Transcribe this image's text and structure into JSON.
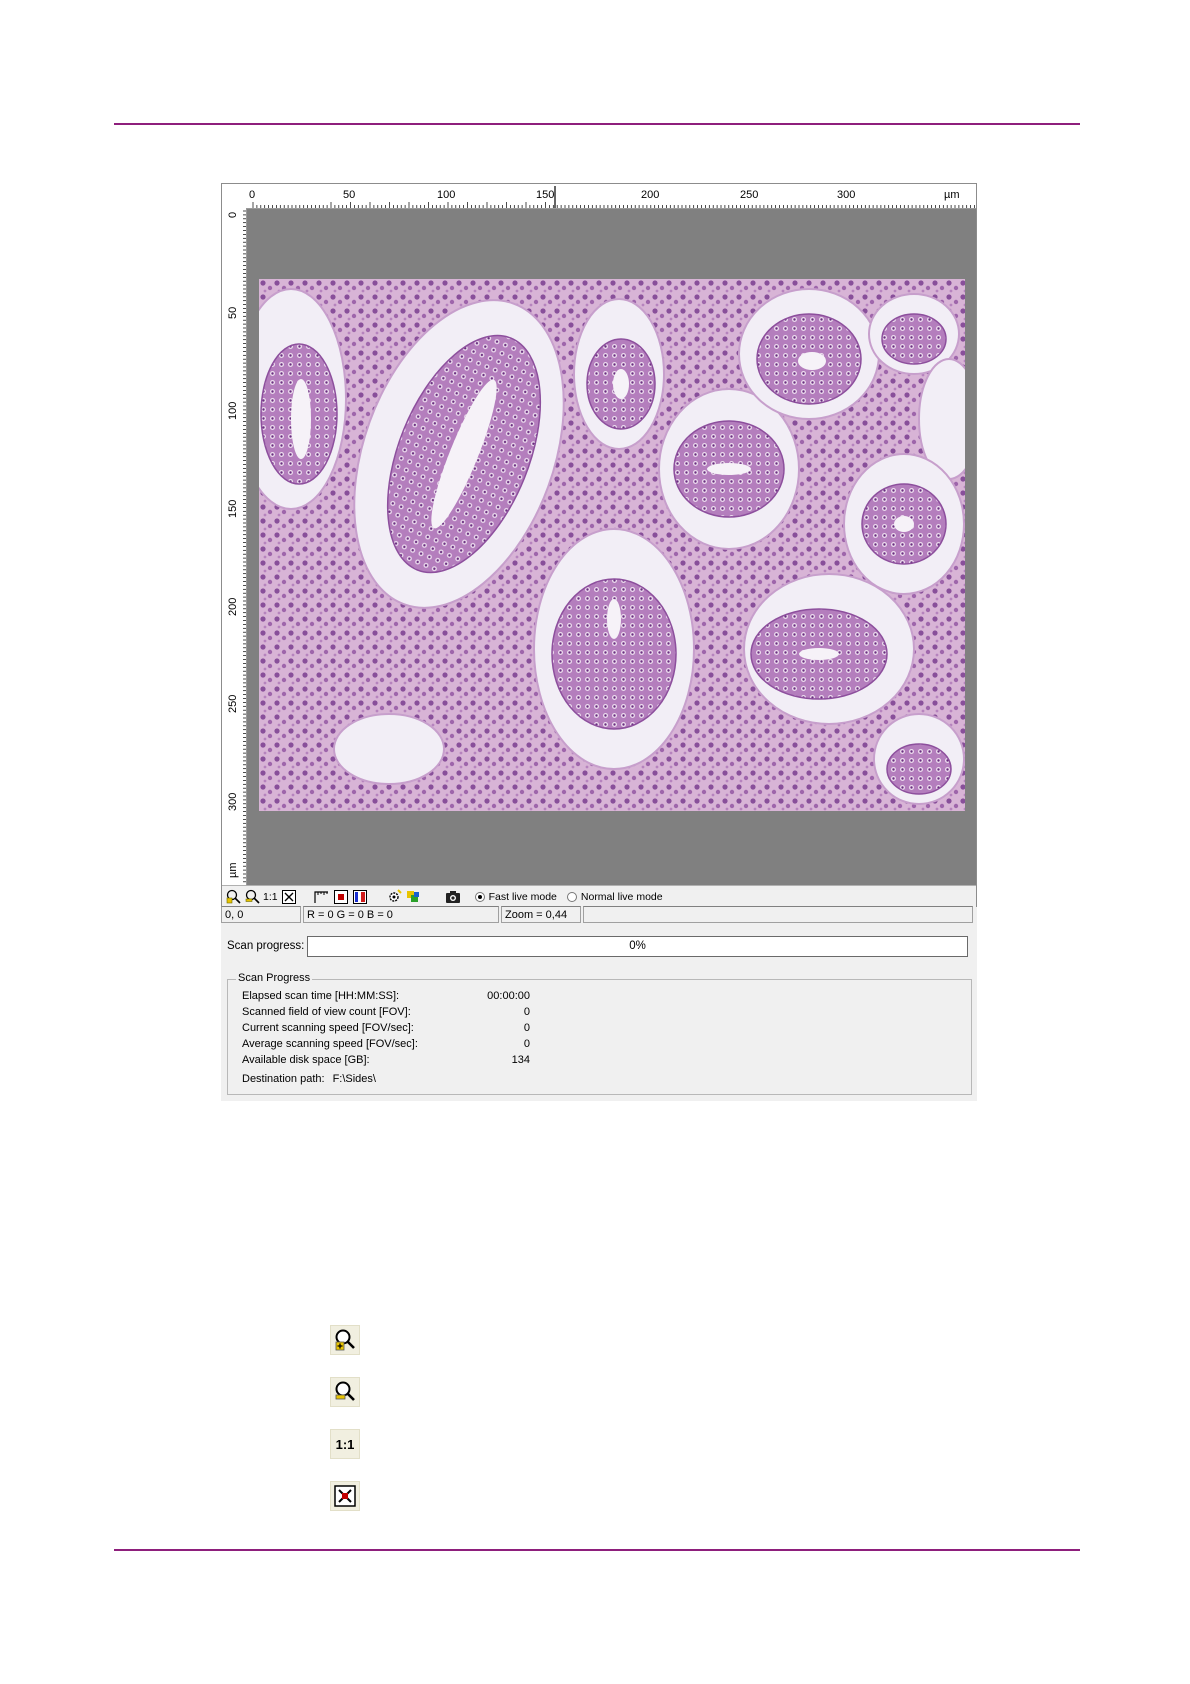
{
  "colors": {
    "accent_rule": "#8e1f7c",
    "canvas_gray": "#808080",
    "tissue_pink": "#d9b7d6",
    "nucleus": "#7a3d8f"
  },
  "ruler": {
    "unit": "µm",
    "top_ticks": [
      "0",
      "50",
      "100",
      "150",
      "200",
      "250",
      "300"
    ],
    "left_ticks": [
      "0",
      "50",
      "100",
      "150",
      "200",
      "250",
      "300"
    ]
  },
  "toolbar": {
    "one_to_one": "1:1",
    "modes": [
      {
        "label": "Fast live mode",
        "selected": true
      },
      {
        "label": "Normal live mode",
        "selected": false
      }
    ],
    "icons": [
      "zoom-in-icon",
      "zoom-out-icon",
      "one-to-one-icon",
      "fit-to-window-icon",
      "ruler-icon",
      "color-frame-icon",
      "color-channels-icon",
      "settings-icon",
      "color-balance-icon",
      "camera-icon"
    ]
  },
  "status": {
    "coords": "0, 0",
    "rgb": "R = 0  G = 0  B = 0",
    "zoom": "Zoom = 0,44"
  },
  "progress": {
    "label": "Scan progress:",
    "percent_text": "0%",
    "value": 0
  },
  "scan_group": {
    "title": "Scan Progress",
    "rows": [
      {
        "label": "Elapsed scan time [HH:MM:SS]:",
        "value": "00:00:00"
      },
      {
        "label": "Scanned field of view count [FOV]:",
        "value": "0"
      },
      {
        "label": "Current scanning speed [FOV/sec]:",
        "value": "0"
      },
      {
        "label": "Average scanning speed [FOV/sec]:",
        "value": "0"
      },
      {
        "label": "Available disk space [GB]:",
        "value": "134"
      }
    ],
    "destination_label": "Destination path:",
    "destination_value": "F:\\Sides\\"
  },
  "legend_icons": [
    {
      "name": "zoom-in-icon"
    },
    {
      "name": "zoom-out-icon"
    },
    {
      "name": "one-to-one-icon",
      "text": "1:1"
    },
    {
      "name": "fit-to-window-icon"
    }
  ]
}
